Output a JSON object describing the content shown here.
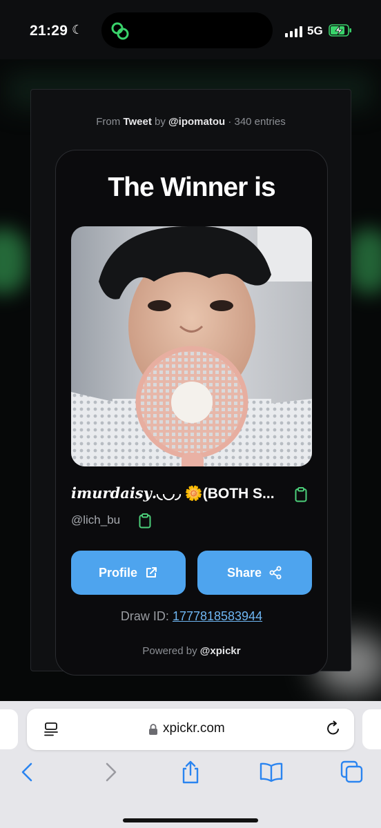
{
  "status_bar": {
    "time": "21:29",
    "network": "5G"
  },
  "card": {
    "source_prefix": "From",
    "source_type": "Tweet",
    "source_by": "by",
    "source_user": "@ipomatou",
    "source_entries": "· 340 entries",
    "title": "The Winner is",
    "winner_name_script": "𝒊𝒎𝒖𝒓𝒅𝒂𝒊𝒔𝒚.",
    "winner_name_rest": "◟◡◞ 🌼(BOTH S...",
    "winner_handle": "@lich_bu",
    "profile_label": "Profile",
    "share_label": "Share",
    "draw_label": "Draw ID:",
    "draw_id": "1777818583944",
    "powered_prefix": "Powered by",
    "powered_brand": "@xpickr"
  },
  "browser": {
    "url": "xpickr.com"
  },
  "colors": {
    "accent": "#4ea4ee",
    "link": "#6fb7f3",
    "clipboard": "#4cd07a",
    "brand_green": "#39d36b"
  },
  "icons": [
    "moon-icon",
    "app-logo-icon",
    "signal-icon",
    "battery-charging-icon",
    "clipboard-icon",
    "external-link-icon",
    "share-icon",
    "reader-icon",
    "lock-icon",
    "reload-icon",
    "back-icon",
    "forward-icon",
    "share-sheet-icon",
    "bookmarks-icon",
    "tabs-icon"
  ]
}
